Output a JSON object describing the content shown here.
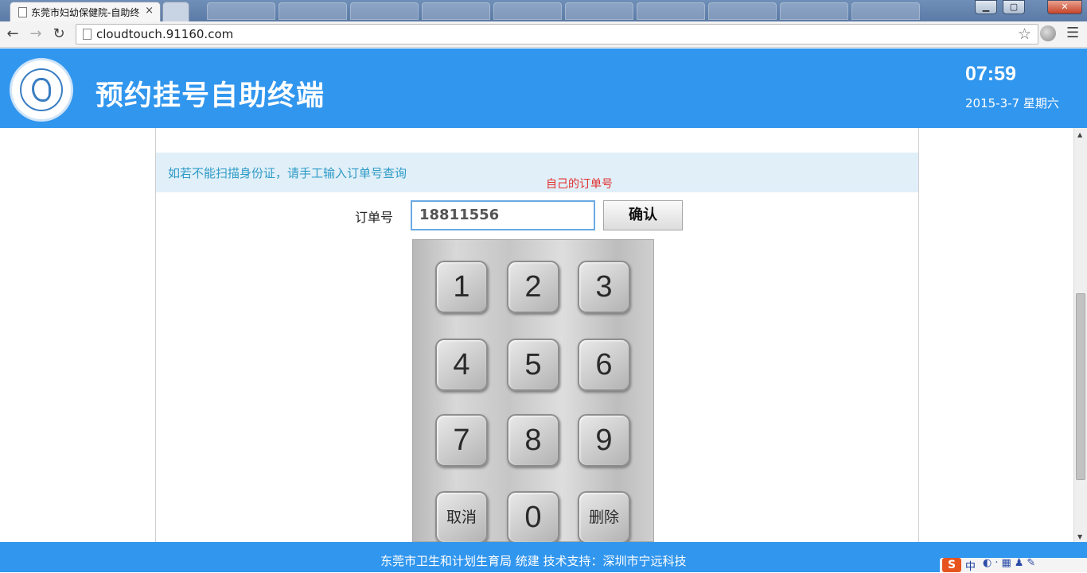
{
  "browser": {
    "active_tab_title": "东莞市妇幼保健院-自助终",
    "tab_close": "×",
    "url": "cloudtouch.91160.com",
    "window_buttons": [
      "▁",
      "▢",
      "✕"
    ]
  },
  "header": {
    "title": "预约挂号自助终端",
    "clock": "07:59",
    "date": "2015-3-7 星期六"
  },
  "main": {
    "notice": "如若不能扫描身份证，请手工输入订单号查询",
    "annotation": "自己的订单号",
    "order_label": "订单号",
    "order_value": "18811556",
    "confirm_label": "确认",
    "keypad": [
      [
        "1",
        "2",
        "3"
      ],
      [
        "4",
        "5",
        "6"
      ],
      [
        "7",
        "8",
        "9"
      ],
      [
        "取消",
        "0",
        "删除"
      ]
    ]
  },
  "footer": {
    "text": "东莞市卫生和计划生育局 统建 技术支持：深圳市宁远科技",
    "ime_logo": "S",
    "ime_lang": "中"
  },
  "colors": {
    "brand_blue": "#3196ee",
    "notice_bg": "#e1eff8",
    "notice_text": "#2e9bc7",
    "annotation": "#e03030"
  }
}
